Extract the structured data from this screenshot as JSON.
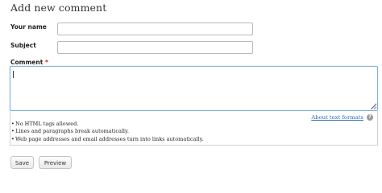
{
  "form": {
    "heading": "Add new comment",
    "name_label": "Your name",
    "name_value": "",
    "subject_label": "Subject",
    "subject_value": "",
    "comment_label": "Comment",
    "required_marker": "*",
    "comment_value": ""
  },
  "format": {
    "about_link": "About text formats",
    "help_icon_glyph": "?",
    "tips": [
      "No HTML tags allowed.",
      "Lines and paragraphs break automatically.",
      "Web page addresses and email addresses turn into links automatically."
    ],
    "bullet": "•"
  },
  "actions": {
    "save_label": "Save",
    "preview_label": "Preview"
  },
  "colors": {
    "link": "#2a6bb3",
    "required": "#cc2222",
    "focus_border": "#7fb2db"
  }
}
